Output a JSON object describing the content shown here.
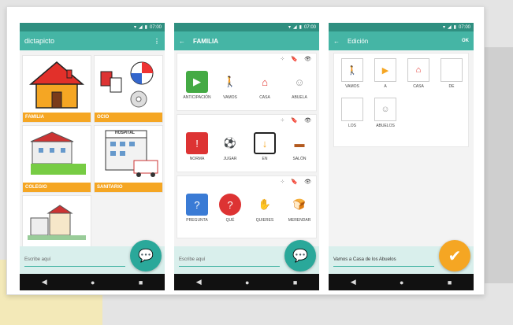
{
  "status": {
    "time": "07:00"
  },
  "phone1": {
    "title": "dictapicto",
    "categories": [
      {
        "label": "FAMILIA"
      },
      {
        "label": "OCIO"
      },
      {
        "label": "COLEGIO"
      },
      {
        "label": "SANITARIO"
      },
      {
        "label": ""
      }
    ],
    "hospital_sign": "HOSPITAL",
    "input_placeholder": "Escribe aquí"
  },
  "phone2": {
    "title": "FAMILIA",
    "rows": [
      [
        "ANTICIPACIÓN",
        "VAMOS",
        "CASA",
        "ABUELA"
      ],
      [
        "NORMA",
        "JUGAR",
        "EN",
        "SALÓN"
      ],
      [
        "PREGUNTA",
        "QUÉ",
        "QUIERES",
        "MERENDAR"
      ]
    ],
    "input_placeholder": "Escribe aquí"
  },
  "phone3": {
    "title": "Edición",
    "action": "OK",
    "tiles": [
      "VAMOS",
      "A",
      "CASA",
      "DE",
      "LOS",
      "ABUELOS"
    ],
    "sentence": "Vamos a Casa de los Abuelos"
  },
  "nav": {
    "back": "◀",
    "home": "●",
    "recent": "■"
  },
  "colors": {
    "teal": "#45b5a5",
    "orange": "#f5a623",
    "dark": "#2f8f80"
  }
}
